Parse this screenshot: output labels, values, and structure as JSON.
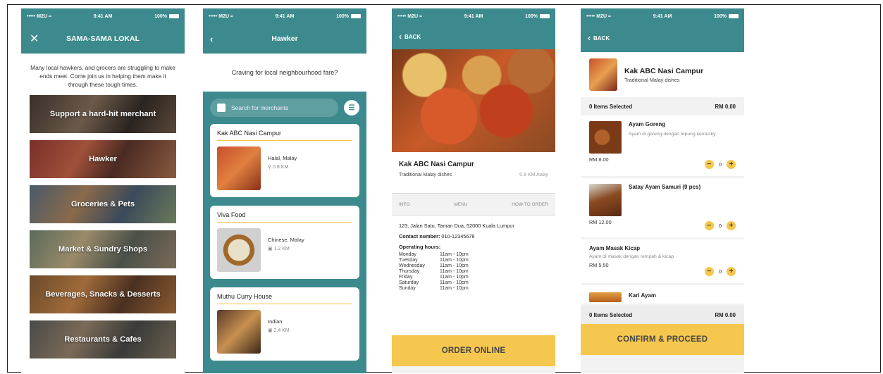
{
  "status": {
    "carrier": "M2U",
    "time": "9:41 AM",
    "battery": "100%"
  },
  "screen1": {
    "title": "SAMA-SAMA LOKAL",
    "intro": "Many local hawkers, and grocers are struggling to make ends meet. Come join us in helping them make it through these tough times.",
    "categories": [
      "Support a hard-hit merchant",
      "Hawker",
      "Groceries & Pets",
      "Market & Sundry Shops",
      "Beverages, Snacks & Desserts",
      "Restaurants & Cafes"
    ]
  },
  "screen2": {
    "title": "Hawker",
    "prompt": "Craving for local neighbourhood fare?",
    "search_placeholder": "Search for merchants",
    "merchants": [
      {
        "name": "Kak ABC Nasi Campur",
        "cuisine": "Halal, Malay",
        "distance": "0.8 KM"
      },
      {
        "name": "Viva Food",
        "cuisine": "Chinese, Malay",
        "distance": "1.2 KM"
      },
      {
        "name": "Muthu Curry House",
        "cuisine": "Indian",
        "distance": "2.4 KM"
      }
    ]
  },
  "screen3": {
    "back": "BACK",
    "name": "Kak ABC Nasi Campur",
    "subtitle": "Traditional Malay dishes",
    "distance": "0.8 KM Away",
    "tabs": [
      "INFO",
      "MENU",
      "HOW TO ORDER"
    ],
    "address": "123, Jalan Satu, Taman Dua, 52000 Kuala Lumpur",
    "contact_label": "Contact number:",
    "contact": "010-12345678",
    "hours_label": "Operating hours:",
    "hours": [
      {
        "day": "Monday",
        "time": "11am - 10pm"
      },
      {
        "day": "Tuesday",
        "time": "11am - 10pm"
      },
      {
        "day": "Wednesday",
        "time": "11am - 10pm"
      },
      {
        "day": "Thursday",
        "time": "11am - 10pm"
      },
      {
        "day": "Friday",
        "time": "11am - 10pm"
      },
      {
        "day": "Saturday",
        "time": "11am - 10pm"
      },
      {
        "day": "Sunday",
        "time": "11am - 10pm"
      }
    ],
    "cta": "ORDER ONLINE"
  },
  "screen4": {
    "back": "BACK",
    "name": "Kak ABC Nasi Campur",
    "subtitle": "Traditional Malay dishes",
    "selected": "0 Items Selected",
    "total": "RM 0.00",
    "items": [
      {
        "name": "Ayam Goreng",
        "desc": "Ayam di goreng dengan tepung kentucky",
        "price": "RM 8.00",
        "qty": "0"
      },
      {
        "name": "Satay Ayam Samuri (9 pcs)",
        "desc": "",
        "price": "RM 12.00",
        "qty": "0"
      },
      {
        "name": "Ayam Masak Kicap",
        "desc": "Ayam di masak dengan rempah & kicap",
        "price": "RM 5.50",
        "qty": "0"
      },
      {
        "name": "Kari Ayam",
        "desc": "",
        "price": "",
        "qty": ""
      }
    ],
    "cta": "CONFIRM & PROCEED"
  }
}
